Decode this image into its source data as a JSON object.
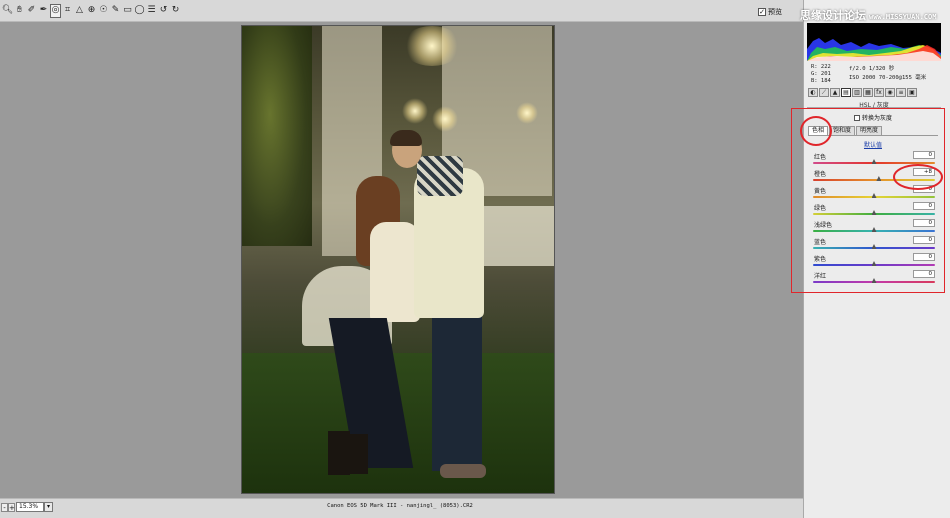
{
  "toolbar": {
    "tools": [
      "zoom-tool",
      "hand-tool",
      "white-balance-tool",
      "color-sampler-tool",
      "target-adjust-tool",
      "crop-tool",
      "straighten-tool",
      "spot-removal-tool",
      "red-eye-tool",
      "adjustment-brush-tool",
      "graduated-filter-tool",
      "preferences",
      "rotate-left",
      "rotate-right"
    ],
    "preview_label": "预览"
  },
  "watermark": {
    "text": "思缘设计论坛",
    "url": "www.MISSYUAN.COM"
  },
  "histogram": {
    "r": "R:  222",
    "g": "G:  201",
    "b": "B:  184",
    "aperture_shutter": "f/2.0   1/320 秒",
    "iso_lens": "ISO 2000   70-200@155 毫米"
  },
  "panel": {
    "section_title": "HSL / 灰度",
    "convert_grayscale": "转换为灰度",
    "tabs": [
      "色相",
      "饱和度",
      "明亮度"
    ],
    "active_tab": 0,
    "default_link": "默认值",
    "sliders": [
      {
        "label": "红色",
        "value": "0",
        "level": 0.5,
        "gradient": "linear-gradient(90deg,#d14a8a,#e3362c,#e38a2c)"
      },
      {
        "label": "橙色",
        "value": "+8",
        "level": 0.54,
        "gradient": "linear-gradient(90deg,#d8402d,#e5902a,#e0cd32)"
      },
      {
        "label": "黄色",
        "value": "0",
        "level": 0.5,
        "gradient": "linear-gradient(90deg,#e08a2a,#e6d435,#93c43b)"
      },
      {
        "label": "绿色",
        "value": "0",
        "level": 0.5,
        "gradient": "linear-gradient(90deg,#d4cf36,#3ead3f,#38b2a6)"
      },
      {
        "label": "浅绿色",
        "value": "0",
        "level": 0.5,
        "gradient": "linear-gradient(90deg,#3aaf42,#35b2b2,#3a73d2)"
      },
      {
        "label": "蓝色",
        "value": "0",
        "level": 0.5,
        "gradient": "linear-gradient(90deg,#38b1b0,#2f55cf,#6b38c9)"
      },
      {
        "label": "紫色",
        "value": "0",
        "level": 0.5,
        "gradient": "linear-gradient(90deg,#2f4bd0,#6a3ac9,#b23ab3)"
      },
      {
        "label": "洋红",
        "value": "0",
        "level": 0.5,
        "gradient": "linear-gradient(90deg,#7a3ac8,#c23aa9,#d83a5c)"
      }
    ]
  },
  "statusbar": {
    "zoom": "15.3%",
    "file_info": "Canon EOS 5D Mark III - nanjingl_ (8053).CR2"
  },
  "annotations_color": "#e0262b"
}
